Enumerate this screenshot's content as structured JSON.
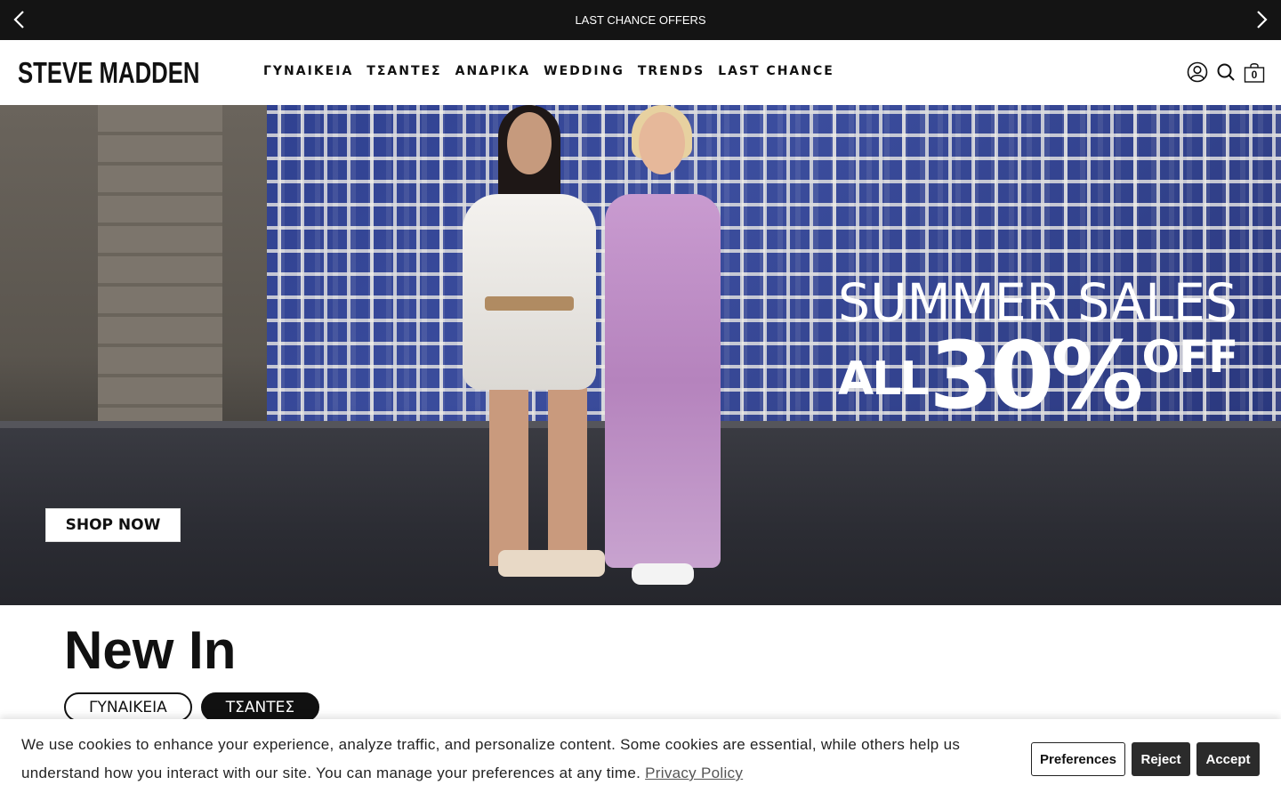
{
  "announcement": {
    "text": "LAST CHANCE OFFERS"
  },
  "header": {
    "logo": "STEVE MADDEN",
    "nav": [
      "ΓΥΝΑΙΚΕΙΑ",
      "ΤΣΑΝΤΕΣ",
      "ΑΝΔΡΙΚΑ",
      "WEDDING",
      "TRENDS",
      "LAST CHANCE"
    ],
    "cart_count": "0"
  },
  "hero": {
    "line1": "SUMMER SALES",
    "all": "ALL",
    "percent": "30%",
    "off": "OFF",
    "cta": "SHOP NOW"
  },
  "new_in": {
    "title": "New In",
    "tabs": [
      "ΓΥΝΑΙΚΕΙΑ",
      "ΤΣΑΝΤΕΣ"
    ],
    "active_tab": "ΤΣΑΝΤΕΣ"
  },
  "cookie": {
    "text": "We use cookies to enhance your experience, analyze traffic, and personalize content. Some cookies are essential, while others help us understand how you interact with our site. You can manage your preferences at any time.",
    "privacy_link": "Privacy Policy",
    "preferences": "Preferences",
    "reject": "Reject",
    "accept": "Accept"
  }
}
